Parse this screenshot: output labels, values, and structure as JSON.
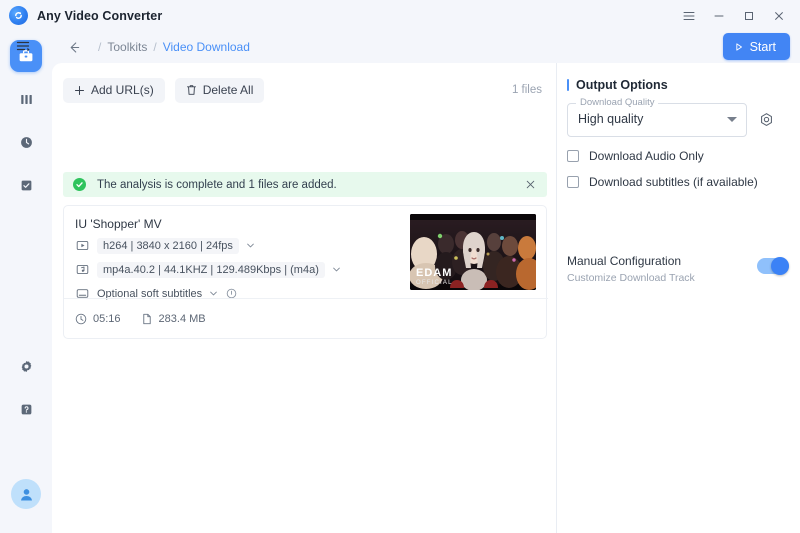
{
  "window": {
    "app_title": "Any Video Converter",
    "logo_icon": "avc-logo-icon",
    "controls": {
      "menu": "hamburger-menu-icon",
      "minimize": "minimize-icon",
      "maximize": "maximize-icon",
      "close": "close-icon"
    }
  },
  "topnav": {
    "collapse_icon": "collapse-sidebar-icon",
    "back_icon": "back-arrow-icon",
    "breadcrumb": {
      "sep": "/",
      "parent": "Toolkits",
      "current": "Video Download"
    },
    "start_label": "Start",
    "start_icon": "play-icon",
    "start_color": "#4285f4"
  },
  "sidebar": {
    "items": [
      {
        "name": "toolkits",
        "icon": "toolbox-icon",
        "active": true
      },
      {
        "name": "library",
        "icon": "library-icon",
        "active": false
      },
      {
        "name": "history",
        "icon": "clock-icon",
        "active": false
      },
      {
        "name": "tasks",
        "icon": "checklist-icon",
        "active": false
      }
    ],
    "bottom_items": [
      {
        "name": "settings",
        "icon": "gear-icon"
      },
      {
        "name": "help",
        "icon": "help-icon"
      }
    ],
    "avatar_icon": "user-avatar-icon",
    "active_color": "#4a90f7"
  },
  "toolbar": {
    "add_url_label": "Add URL(s)",
    "add_url_icon": "plus-icon",
    "delete_all_label": "Delete All",
    "delete_all_icon": "trash-icon",
    "files_count": "1 files"
  },
  "banner": {
    "icon": "success-check-icon",
    "message": "The analysis is complete and 1 files are added.",
    "close_icon": "close-icon",
    "bg_color": "#e7f9ed",
    "accent_color": "#2fc35d"
  },
  "file_card": {
    "title": "IU 'Shopper' MV",
    "video": {
      "icon": "video-track-icon",
      "value": "h264 | 3840 x 2160 | 24fps",
      "chevron": "chevron-down-icon"
    },
    "audio": {
      "icon": "audio-track-icon",
      "value": "mp4a.40.2 | 44.1KHZ | 129.489Kbps | (m4a)",
      "chevron": "chevron-down-icon"
    },
    "subtitles": {
      "icon": "subtitle-track-icon",
      "value": "Optional soft subtitles",
      "chevron": "chevron-down-icon",
      "info_icon": "info-icon"
    },
    "thumbnail": {
      "name": "video-thumbnail",
      "watermark_line1": "EDAM",
      "watermark_line2": "OFFICIAL"
    },
    "duration": {
      "icon": "clock-icon",
      "value": "05:16"
    },
    "filesize": {
      "icon": "file-icon",
      "value": "283.4 MB"
    }
  },
  "output_options": {
    "title": "Output Options",
    "quality": {
      "label": "Download Quality",
      "value": "High quality",
      "caret": "chevron-down-icon"
    },
    "gear_icon": "settings-hex-icon",
    "audio_only": {
      "label": "Download Audio Only",
      "checked": false
    },
    "subtitles": {
      "label": "Download subtitles (if available)",
      "checked": false
    },
    "manual_config": {
      "title": "Manual Configuration",
      "subtitle": "Customize Download Track",
      "enabled": true,
      "toggle_color": "#3b82f6"
    }
  }
}
